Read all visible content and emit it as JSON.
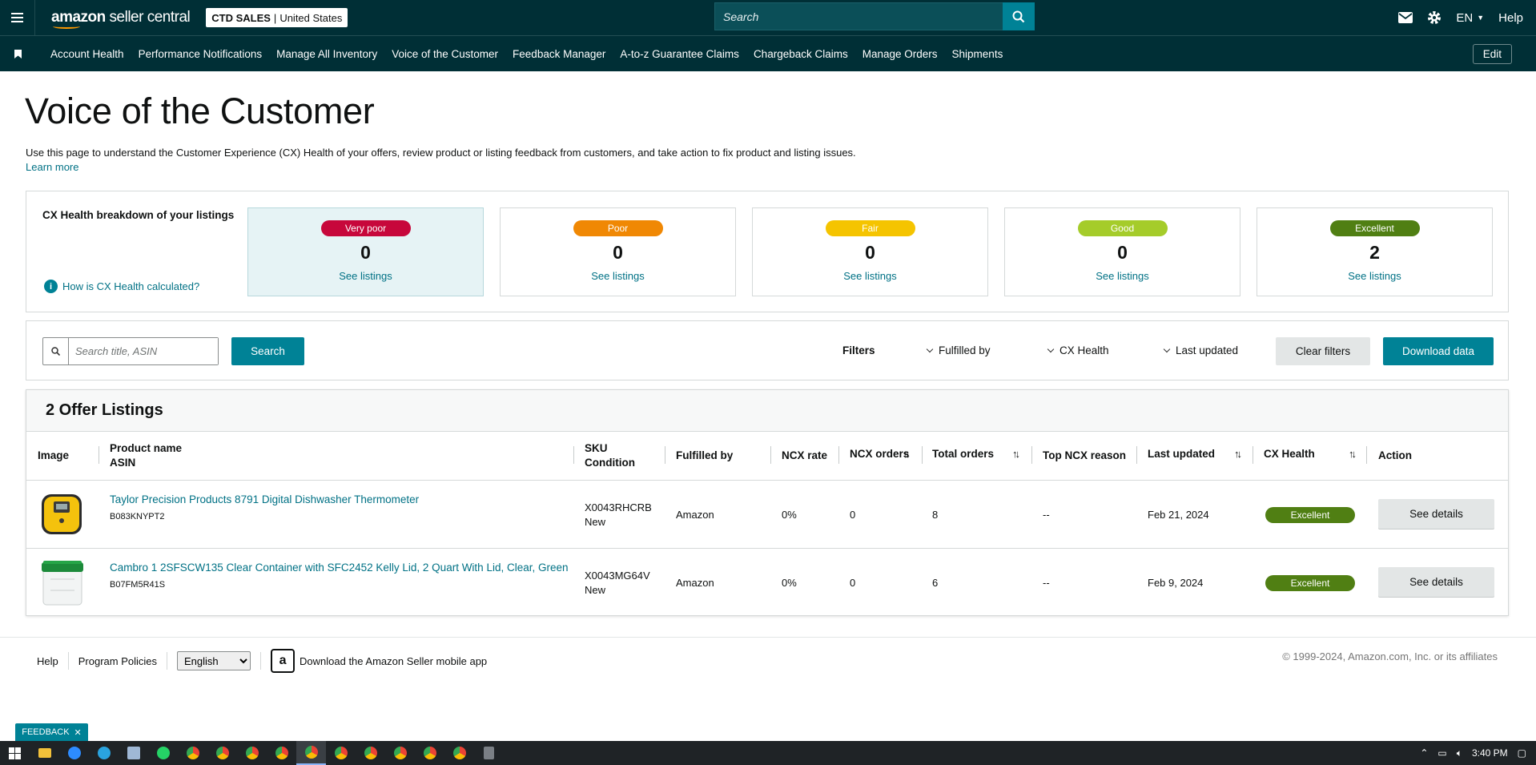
{
  "header": {
    "logo_main": "amazon",
    "logo_sub": "seller central",
    "store_name": "CTD SALES",
    "store_region": "United States",
    "search_placeholder": "Search",
    "lang": "EN",
    "help": "Help"
  },
  "nav": {
    "items": [
      "Account Health",
      "Performance Notifications",
      "Manage All Inventory",
      "Voice of the Customer",
      "Feedback Manager",
      "A-to-z Guarantee Claims",
      "Chargeback Claims",
      "Manage Orders",
      "Shipments"
    ],
    "edit": "Edit"
  },
  "page": {
    "title": "Voice of the Customer",
    "intro": "Use this page to understand the Customer Experience (CX) Health of your offers, review product or listing feedback from customers, and take action to fix product and listing issues.",
    "learn_more": "Learn more"
  },
  "cx_health": {
    "title": "CX Health breakdown of your listings",
    "how_link": "How is CX Health calculated?",
    "cards": [
      {
        "label": "Very poor",
        "count": "0",
        "link": "See listings",
        "color": "#c7073b"
      },
      {
        "label": "Poor",
        "count": "0",
        "link": "See listings",
        "color": "#f08804"
      },
      {
        "label": "Fair",
        "count": "0",
        "link": "See listings",
        "color": "#f5c400"
      },
      {
        "label": "Good",
        "count": "0",
        "link": "See listings",
        "color": "#a5cc2a"
      },
      {
        "label": "Excellent",
        "count": "2",
        "link": "See listings",
        "color": "#507f13"
      }
    ]
  },
  "filters": {
    "search_placeholder": "Search title, ASIN",
    "search_button": "Search",
    "label": "Filters",
    "fulfilled_by": "Fulfilled by",
    "cx_health": "CX Health",
    "last_updated": "Last updated",
    "clear": "Clear filters",
    "download": "Download data"
  },
  "table": {
    "heading": "2 Offer Listings",
    "columns": {
      "image": "Image",
      "product_name": "Product name",
      "asin": "ASIN",
      "sku": "SKU",
      "condition": "Condition",
      "fulfilled_by": "Fulfilled by",
      "ncx_rate": "NCX rate",
      "ncx_orders": "NCX orders",
      "total_orders": "Total orders",
      "top_ncx_reason": "Top NCX reason",
      "last_updated": "Last updated",
      "cx_health": "CX Health",
      "action": "Action"
    },
    "rows": [
      {
        "name": "Taylor Precision Products 8791 Digital Dishwasher Thermometer",
        "asin": "B083KNYPT2",
        "sku": "X0043RHCRB",
        "condition": "New",
        "fulfilled_by": "Amazon",
        "ncx_rate": "0%",
        "ncx_orders": "0",
        "total_orders": "8",
        "top_reason": "--",
        "last_updated": "Feb 21, 2024",
        "health": "Excellent",
        "action": "See details"
      },
      {
        "name": "Cambro 1 2SFSCW135 Clear Container with SFC2452 Kelly Lid, 2 Quart With Lid, Clear, Green",
        "asin": "B07FM5R41S",
        "sku": "X0043MG64V",
        "condition": "New",
        "fulfilled_by": "Amazon",
        "ncx_rate": "0%",
        "ncx_orders": "0",
        "total_orders": "6",
        "top_reason": "--",
        "last_updated": "Feb 9, 2024",
        "health": "Excellent",
        "action": "See details"
      }
    ]
  },
  "footer": {
    "help": "Help",
    "policies": "Program Policies",
    "language": "English",
    "app_text": "Download the Amazon Seller mobile app",
    "copyright": "© 1999-2024, Amazon.com, Inc. or its affiliates"
  },
  "feedback": {
    "label": "FEEDBACK"
  },
  "taskbar": {
    "time": "3:40 PM"
  }
}
